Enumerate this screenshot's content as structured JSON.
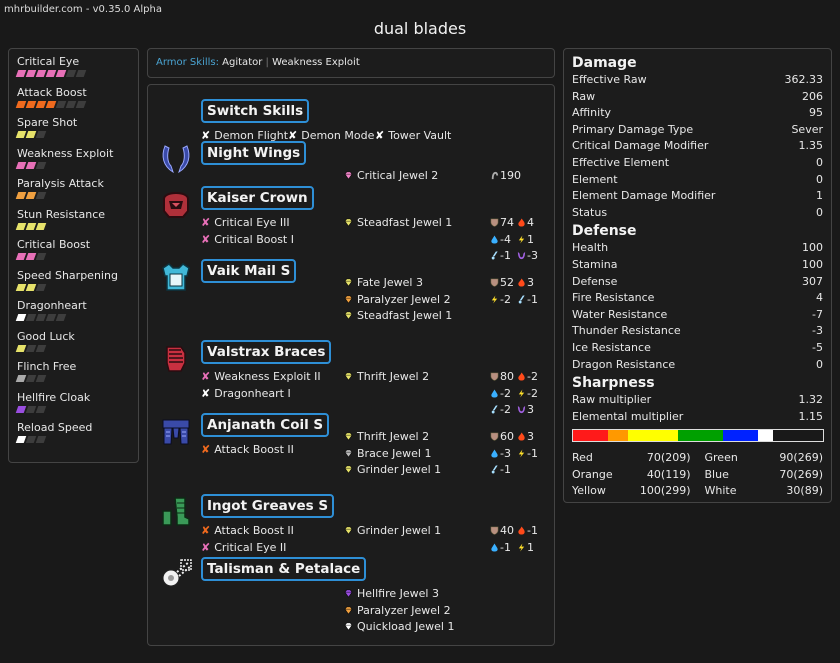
{
  "app": {
    "version": "mhrbuilder.com - v0.35.0 Alpha",
    "title": "dual blades"
  },
  "skills": [
    {
      "name": "Critical Eye",
      "filled": 5,
      "total": 7,
      "color": "#e870b8"
    },
    {
      "name": "Attack Boost",
      "filled": 4,
      "total": 7,
      "color": "#f06a1e"
    },
    {
      "name": "Spare Shot",
      "filled": 2,
      "total": 3,
      "color": "#e6e26a"
    },
    {
      "name": "Weakness Exploit",
      "filled": 2,
      "total": 3,
      "color": "#e870b8"
    },
    {
      "name": "Paralysis Attack",
      "filled": 2,
      "total": 3,
      "color": "#f0a040"
    },
    {
      "name": "Stun Resistance",
      "filled": 3,
      "total": 3,
      "color": "#e6e26a"
    },
    {
      "name": "Critical Boost",
      "filled": 2,
      "total": 3,
      "color": "#e870b8"
    },
    {
      "name": "Speed Sharpening",
      "filled": 2,
      "total": 3,
      "color": "#e6e26a"
    },
    {
      "name": "Dragonheart",
      "filled": 1,
      "total": 5,
      "color": "#ffffff"
    },
    {
      "name": "Good Luck",
      "filled": 1,
      "total": 3,
      "color": "#e6e26a"
    },
    {
      "name": "Flinch Free",
      "filled": 1,
      "total": 3,
      "color": "#aaaaaa"
    },
    {
      "name": "Hellfire Cloak",
      "filled": 1,
      "total": 3,
      "color": "#9a4ee0"
    },
    {
      "name": "Reload Speed",
      "filled": 1,
      "total": 3,
      "color": "#ffffff"
    }
  ],
  "armor_skills": {
    "label": "Armor Skills:",
    "items": [
      "Agitator",
      "Weakness Exploit"
    ]
  },
  "equipment": [
    {
      "name": "Switch Skills",
      "icon": "switch-skills-icon",
      "skills": [
        {
          "name": "Demon Flight",
          "color": "#ffffff"
        },
        {
          "name": "Demon Mode",
          "color": "#ffffff"
        },
        {
          "name": "Tower Vault",
          "color": "#ffffff"
        }
      ]
    },
    {
      "name": "Night Wings",
      "icon": "dual-blades-icon",
      "jewels": [
        {
          "name": "Critical Jewel 2",
          "color": "#f085c8"
        }
      ],
      "attack": "190"
    },
    {
      "name": "Kaiser Crown",
      "icon": "helmet-icon",
      "skills": [
        {
          "name": "Critical Eye III",
          "color": "#e870b8"
        },
        {
          "name": "Critical Boost I",
          "color": "#e870b8"
        }
      ],
      "jewels": [
        {
          "name": "Steadfast Jewel 1",
          "color": "#e6e26a"
        }
      ],
      "defense": "74",
      "fire": "4",
      "water": "-4",
      "thunder": "1",
      "ice": "-1",
      "dragon": "-3"
    },
    {
      "name": "Vaik Mail S",
      "icon": "chest-icon",
      "jewels": [
        {
          "name": "Fate Jewel 3",
          "color": "#e6e26a"
        },
        {
          "name": "Paralyzer Jewel 2",
          "color": "#f0a040"
        },
        {
          "name": "Steadfast Jewel 1",
          "color": "#e6e26a"
        }
      ],
      "defense": "52",
      "fire": "3",
      "thunder": "-2",
      "ice": "-1"
    },
    {
      "name": "Valstrax Braces",
      "icon": "arm-icon",
      "skills": [
        {
          "name": "Weakness Exploit II",
          "color": "#e870b8"
        },
        {
          "name": "Dragonheart I",
          "color": "#ffffff"
        }
      ],
      "jewels": [
        {
          "name": "Thrift Jewel 2",
          "color": "#e6e26a"
        }
      ],
      "defense": "80",
      "fire": "-2",
      "water": "-2",
      "thunder": "-2",
      "ice": "-2",
      "dragon": "3"
    },
    {
      "name": "Anjanath Coil S",
      "icon": "waist-icon",
      "skills": [
        {
          "name": "Attack Boost II",
          "color": "#f06a1e"
        }
      ],
      "jewels": [
        {
          "name": "Thrift Jewel 2",
          "color": "#e6e26a"
        },
        {
          "name": "Brace Jewel 1",
          "color": "#bbbbbb"
        },
        {
          "name": "Grinder Jewel 1",
          "color": "#e6e26a"
        }
      ],
      "defense": "60",
      "fire": "3",
      "water": "-3",
      "thunder": "-1",
      "ice": "-1"
    },
    {
      "name": "Ingot Greaves S",
      "icon": "leg-icon",
      "skills": [
        {
          "name": "Attack Boost II",
          "color": "#f06a1e"
        },
        {
          "name": "Critical Eye II",
          "color": "#e870b8"
        }
      ],
      "jewels": [
        {
          "name": "Grinder Jewel 1",
          "color": "#e6e26a"
        }
      ],
      "defense": "40",
      "fire": "-1",
      "water": "-1",
      "thunder": "1"
    },
    {
      "name": "Talisman & Petalace",
      "icon": "talisman-icon",
      "jewels": [
        {
          "name": "Hellfire Jewel 3",
          "color": "#9a4ee0"
        },
        {
          "name": "Paralyzer Jewel 2",
          "color": "#f0a040"
        },
        {
          "name": "Quickload Jewel 1",
          "color": "#ffffff"
        }
      ]
    }
  ],
  "stats": {
    "damage_title": "Damage",
    "damage": [
      {
        "label": "Effective Raw",
        "value": "362.33"
      },
      {
        "label": "Raw",
        "value": "206"
      },
      {
        "label": "Affinity",
        "value": "95"
      },
      {
        "label": "Primary Damage Type",
        "value": "Sever"
      },
      {
        "label": "Critical Damage Modifier",
        "value": "1.35"
      },
      {
        "label": "Effective Element",
        "value": "0"
      },
      {
        "label": "Element",
        "value": "0"
      },
      {
        "label": "Element Damage Modifier",
        "value": "1"
      },
      {
        "label": "Status",
        "value": "0"
      }
    ],
    "defense_title": "Defense",
    "defense": [
      {
        "label": "Health",
        "value": "100"
      },
      {
        "label": "Stamina",
        "value": "100"
      },
      {
        "label": "Defense",
        "value": "307"
      },
      {
        "label": "Fire Resistance",
        "value": "4"
      },
      {
        "label": "Water Resistance",
        "value": "-7"
      },
      {
        "label": "Thunder Resistance",
        "value": "-3"
      },
      {
        "label": "Ice Resistance",
        "value": "-5"
      },
      {
        "label": "Dragon Resistance",
        "value": "0"
      }
    ],
    "sharpness_title": "Sharpness",
    "sharpness": [
      {
        "label": "Raw multiplier",
        "value": "1.32"
      },
      {
        "label": "Elemental multiplier",
        "value": "1.15"
      }
    ],
    "sharpness_bar": [
      {
        "color": "#ff1a1a",
        "hits": 70
      },
      {
        "color": "#ff9900",
        "hits": 40
      },
      {
        "color": "#ffff00",
        "hits": 100
      },
      {
        "color": "#00a000",
        "hits": 90
      },
      {
        "color": "#0022ff",
        "hits": 70
      },
      {
        "color": "#ffffff",
        "hits": 30
      },
      {
        "color": "#191919",
        "hits": 100
      }
    ],
    "sharpness_levels": [
      {
        "label": "Red",
        "value": "70(209)"
      },
      {
        "label": "Green",
        "value": "90(269)"
      },
      {
        "label": "Orange",
        "value": "40(119)"
      },
      {
        "label": "Blue",
        "value": "70(269)"
      },
      {
        "label": "Yellow",
        "value": "100(299)"
      },
      {
        "label": "White",
        "value": "30(89)"
      }
    ]
  }
}
